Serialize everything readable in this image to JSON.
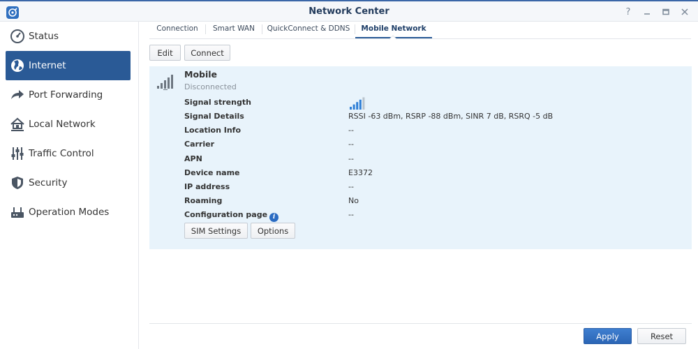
{
  "window": {
    "title": "Network Center",
    "controls": [
      "help-icon",
      "minimize-icon",
      "maximize-icon",
      "close-icon"
    ]
  },
  "sidebar": {
    "items": [
      {
        "label": "Status",
        "icon": "status-gauge-icon"
      },
      {
        "label": "Internet",
        "icon": "globe-icon",
        "active": true
      },
      {
        "label": "Port Forwarding",
        "icon": "forward-arrow-icon"
      },
      {
        "label": "Local Network",
        "icon": "home-network-icon"
      },
      {
        "label": "Traffic Control",
        "icon": "sliders-icon"
      },
      {
        "label": "Security",
        "icon": "shield-icon"
      },
      {
        "label": "Operation Modes",
        "icon": "router-icon"
      }
    ]
  },
  "tabs": [
    {
      "label": "Connection"
    },
    {
      "label": "Smart WAN"
    },
    {
      "label": "QuickConnect & DDNS"
    },
    {
      "label": "Mobile Network",
      "active": true
    }
  ],
  "toolbar": {
    "edit_label": "Edit",
    "connect_label": "Connect"
  },
  "mobile": {
    "title": "Mobile",
    "status": "Disconnected",
    "signal_strength_bars": 4,
    "signal_strength_max": 5,
    "rows": [
      {
        "label": "Signal strength",
        "value": ""
      },
      {
        "label": "Signal Details",
        "value": "RSSI -63 dBm, RSRP -88 dBm, SINR 7 dB, RSRQ -5 dB"
      },
      {
        "label": "Location Info",
        "value": "--"
      },
      {
        "label": "Carrier",
        "value": "--"
      },
      {
        "label": "APN",
        "value": "--"
      },
      {
        "label": "Device name",
        "value": "E3372"
      },
      {
        "label": "IP address",
        "value": "--"
      },
      {
        "label": "Roaming",
        "value": "No"
      },
      {
        "label": "Configuration page",
        "value": "--"
      }
    ],
    "sim_settings_label": "SIM Settings",
    "options_label": "Options"
  },
  "footer": {
    "apply_label": "Apply",
    "reset_label": "Reset"
  },
  "colors": {
    "accent": "#2a5a96",
    "panel_bg": "#e8f3fb",
    "signal_active": "#2f7fd6",
    "signal_inactive": "#b9c3cd"
  }
}
